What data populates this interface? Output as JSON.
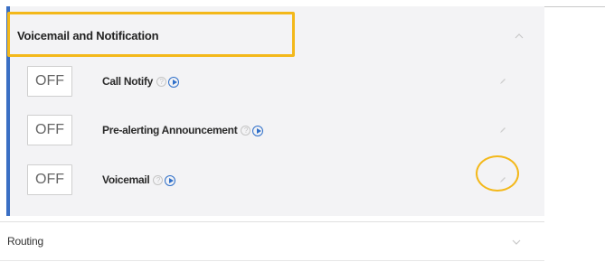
{
  "section": {
    "title": "Voicemail and Notification"
  },
  "rows": [
    {
      "toggle": "OFF",
      "label": "Call Notify"
    },
    {
      "toggle": "OFF",
      "label": "Pre-alerting Announcement"
    },
    {
      "toggle": "OFF",
      "label": "Voicemail"
    }
  ],
  "routing": {
    "label": "Routing"
  },
  "colors": {
    "accent_bar": "#3a6fc4",
    "highlight": "#f3b81a",
    "play_icon": "#2f6fc9"
  }
}
